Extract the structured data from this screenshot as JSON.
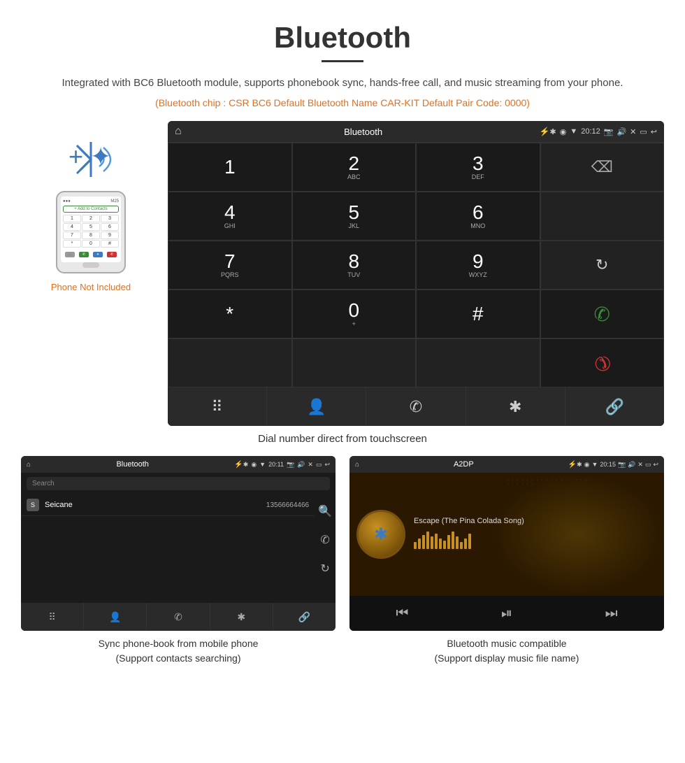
{
  "page": {
    "title": "Bluetooth",
    "subtitle": "Integrated with BC6 Bluetooth module, supports phonebook sync, hands-free call, and music streaming from your phone.",
    "specs": "(Bluetooth chip : CSR BC6    Default Bluetooth Name CAR-KIT    Default Pair Code: 0000)",
    "phone_not_included": "Phone Not Included",
    "dial_caption": "Dial number direct from touchscreen"
  },
  "dialer_screen": {
    "status_bar": {
      "title": "Bluetooth",
      "time": "20:12"
    },
    "keys": [
      {
        "number": "1",
        "letters": ""
      },
      {
        "number": "2",
        "letters": "ABC"
      },
      {
        "number": "3",
        "letters": "DEF"
      },
      {
        "number": "4",
        "letters": "GHI"
      },
      {
        "number": "5",
        "letters": "JKL"
      },
      {
        "number": "6",
        "letters": "MNO"
      },
      {
        "number": "7",
        "letters": "PQRS"
      },
      {
        "number": "8",
        "letters": "TUV"
      },
      {
        "number": "9",
        "letters": "WXYZ"
      },
      {
        "number": "*",
        "letters": ""
      },
      {
        "number": "0",
        "letters": "+"
      },
      {
        "number": "#",
        "letters": ""
      }
    ]
  },
  "contacts_screen": {
    "title": "Bluetooth",
    "time": "20:11",
    "search_placeholder": "Search",
    "contact_name": "Seicane",
    "contact_number": "13566664466",
    "contact_initial": "S",
    "caption_line1": "Sync phone-book from mobile phone",
    "caption_line2": "(Support contacts searching)"
  },
  "music_screen": {
    "title": "A2DP",
    "time": "20:15",
    "song_title": "Escape (The Pina Colada Song)",
    "caption_line1": "Bluetooth music compatible",
    "caption_line2": "(Support display music file name)"
  },
  "phone_mock": {
    "keys": [
      "1",
      "2",
      "3",
      "4",
      "5",
      "6",
      "7",
      "8",
      "9",
      "*",
      "0",
      "#"
    ]
  }
}
